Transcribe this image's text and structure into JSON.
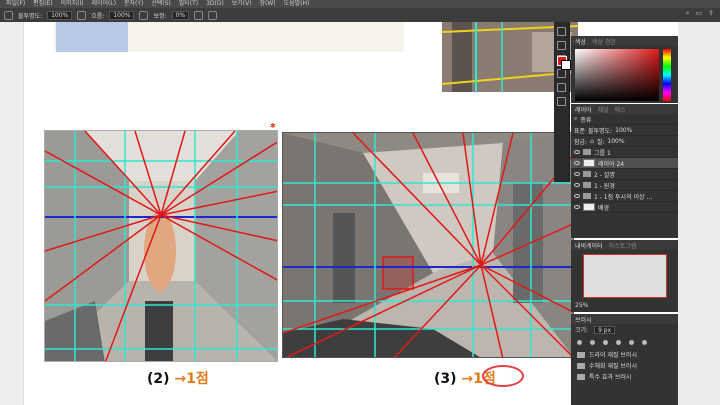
{
  "menubar": {
    "items": [
      "파일(F)",
      "편집(E)",
      "이미지(I)",
      "레이어(L)",
      "문자(Y)",
      "선택(S)",
      "필터(T)",
      "3D(D)",
      "보기(V)",
      "창(W)",
      "도움말(H)"
    ]
  },
  "options": {
    "opacity_label": "불투명도:",
    "opacity_value": "100%",
    "flow_label": "흐름:",
    "flow_value": "100%",
    "smooth_label": "보정:",
    "smooth_value": "0%"
  },
  "canvas": {
    "marker": "✱",
    "caption2": {
      "num": "(2)",
      "arrow": "→",
      "score": "1점"
    },
    "caption3": {
      "num": "(3)",
      "arrow": "→",
      "score": "1점"
    }
  },
  "color_panel": {
    "tab_active": "색상",
    "tab_inactive": "색상 견본"
  },
  "layers_panel": {
    "tabs": [
      "레이어",
      "채널",
      "패스"
    ],
    "kind_label": "종류",
    "blend_mode": "표준",
    "opacity_label": "불투명도:",
    "opacity_value": "100%",
    "lock_label": "잠금:",
    "fill_label": "칠:",
    "fill_value": "100%",
    "layers": [
      "그룹 1",
      "레이어 24",
      "2 - 설명",
      "1 - 원경",
      "1 - 1점 투시의 이상 …",
      "배경"
    ]
  },
  "navigator": {
    "tabs": [
      "내비게이터",
      "히스토그램"
    ],
    "zoom": "25%"
  },
  "brush_panel": {
    "title": "브러시",
    "size_label": "크기:",
    "size_value": "9 px",
    "folders": [
      "드라이 재질 브러시",
      "수채화 재질 브러시",
      "특수 효과 브러시"
    ]
  },
  "colors": {
    "accent": "#e67a18",
    "fg_swatch": "#e01818",
    "guide_cyan": "#2ee8d0",
    "guide_red": "#e01818",
    "guide_blue": "#1a2ad0"
  }
}
